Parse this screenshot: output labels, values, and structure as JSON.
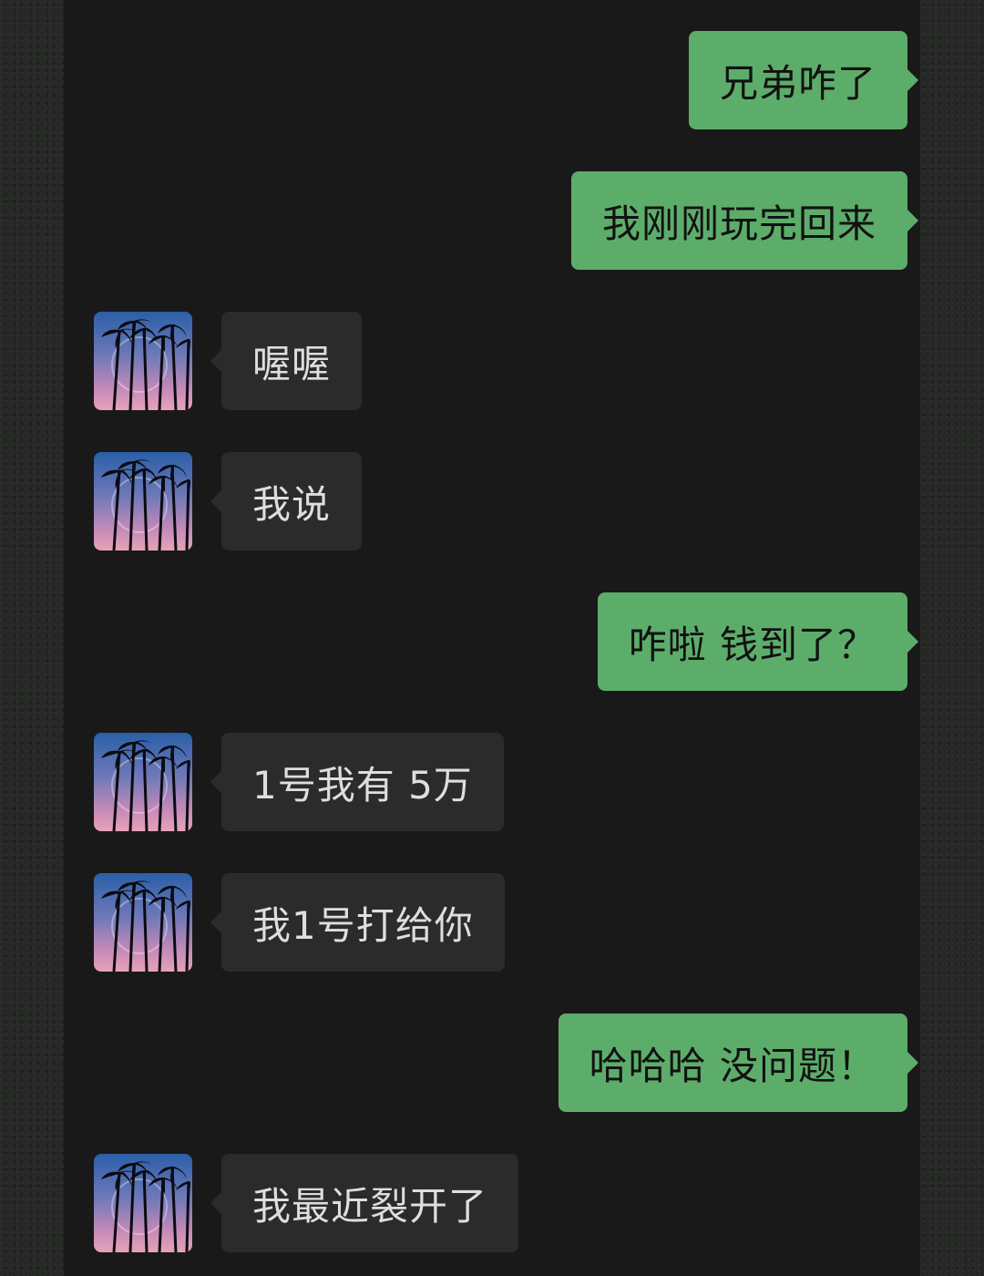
{
  "conversation": {
    "messages": [
      {
        "sender": "me",
        "text": "兄弟咋了"
      },
      {
        "sender": "me",
        "text": "我刚刚玩完回来"
      },
      {
        "sender": "contact",
        "text": "喔喔"
      },
      {
        "sender": "contact",
        "text": "我说"
      },
      {
        "sender": "me",
        "text": "咋啦 钱到了？"
      },
      {
        "sender": "contact",
        "text": "1号我有 5万"
      },
      {
        "sender": "contact",
        "text": "我1号打给你"
      },
      {
        "sender": "me",
        "text": "哈哈哈 没问题！"
      },
      {
        "sender": "contact",
        "text": "我最近裂开了"
      }
    ]
  },
  "colors": {
    "outgoing_bubble": "#5dad6a",
    "incoming_bubble": "#2b2b2b",
    "chat_background": "#191919"
  },
  "icons": {
    "avatar": "contact-avatar-palm-trees"
  }
}
